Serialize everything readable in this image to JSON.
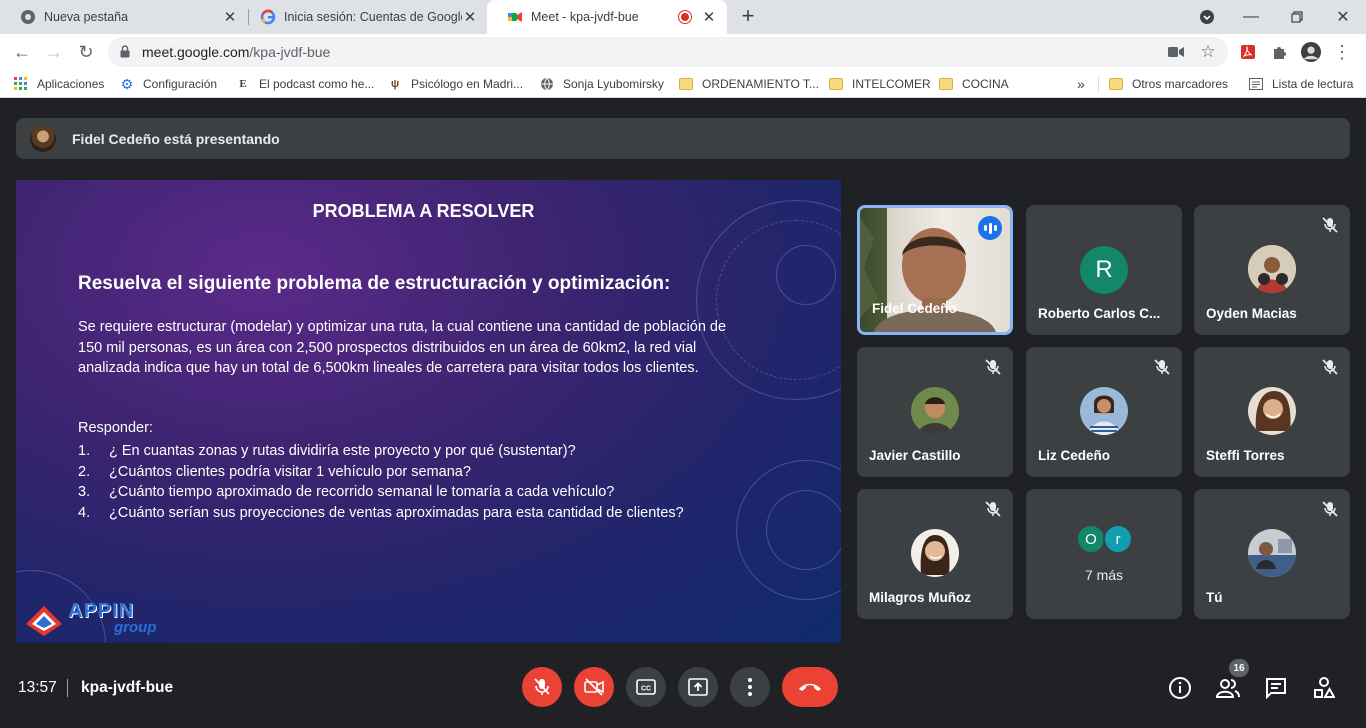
{
  "tabs": [
    {
      "title": "Nueva pestaña",
      "active": false
    },
    {
      "title": "Inicia sesión: Cuentas de Google",
      "active": false
    },
    {
      "title": "Meet - kpa-jvdf-bue",
      "active": true
    }
  ],
  "address": {
    "domain": "meet.google.com",
    "path": "/kpa-jvdf-bue"
  },
  "bookmarks": {
    "items": [
      "Aplicaciones",
      "Configuración",
      "El podcast como he...",
      "Psicólogo en Madri...",
      "Sonja Lyubomirsky",
      "ORDENAMIENTO T...",
      "INTELCOMER",
      "COCINA"
    ],
    "more": "»",
    "other": "Otros marcadores",
    "reading_list": "Lista de lectura"
  },
  "presenting": {
    "text": "Fidel Cedeño está presentando"
  },
  "slide": {
    "title": "PROBLEMA A RESOLVER",
    "subtitle": "Resuelva el siguiente problema de estructuración y optimización:",
    "paragraph": " Se requiere estructurar (modelar) y  optimizar una ruta, la cual contiene una cantidad de población de 150 mil personas, es un área con 2,500 prospectos distribuidos en un área de 60km2, la red vial analizada indica que hay un total de 6,500km lineales de carretera para visitar todos los clientes.",
    "respond_label": "Responder:",
    "questions": [
      {
        "n": "1.",
        "text": "¿ En cuantas zonas y rutas dividiría este proyecto y por qué (sustentar)?"
      },
      {
        "n": "2.",
        "text": "¿Cuántos clientes podría visitar 1 vehículo por semana?"
      },
      {
        "n": "3.",
        "text": "¿Cuánto tiempo aproximado de recorrido semanal le tomaría a cada vehículo?"
      },
      {
        "n": "4.",
        "text": "¿Cuánto serían sus proyecciones de ventas aproximadas para esta cantidad de clientes?"
      }
    ],
    "logo_text": "APPIN",
    "logo_sub": "group"
  },
  "participants": [
    {
      "name": "Fidel Cedeño",
      "speaking": true
    },
    {
      "name": "Roberto Carlos C...",
      "initial": "R",
      "color": "#12876a",
      "muted": false
    },
    {
      "name": "Oyden Macias",
      "muted": true
    },
    {
      "name": "Javier Castillo",
      "muted": true
    },
    {
      "name": "Liz Cedeño",
      "muted": true
    },
    {
      "name": "Steffi Torres",
      "muted": true
    },
    {
      "name": "Milagros Muñoz",
      "muted": true
    },
    {
      "more_label": "7 más",
      "initials": [
        "O",
        "r"
      ]
    },
    {
      "name": "Tú",
      "muted": true
    }
  ],
  "bottom": {
    "time": "13:57",
    "meeting_code": "kpa-jvdf-bue",
    "people_count": "16"
  }
}
